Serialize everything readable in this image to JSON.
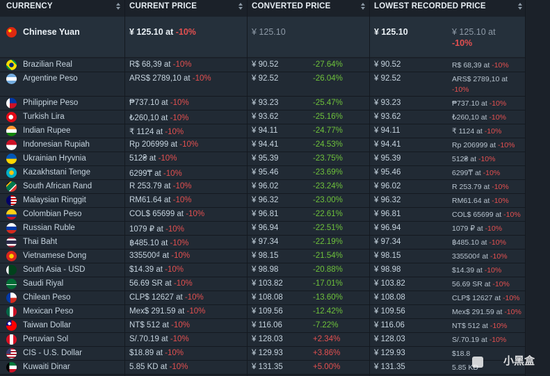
{
  "headers": {
    "currency": "CURRENCY",
    "current_price": "CURRENT PRICE",
    "converted_price": "CONVERTED PRICE",
    "lowest_recorded_price": "LOWEST RECORDED PRICE"
  },
  "featured": {
    "currency": "Chinese Yuan",
    "current": "¥ 125.10 at ",
    "current_disc": "-10%",
    "converted": "¥ 125.10",
    "lowest": "¥ 125.10",
    "lowest_at": "¥ 125.10 at",
    "lowest_disc": "-10%"
  },
  "rows": [
    {
      "currency": "Brazilian Real",
      "current": "R$ 68,39 at ",
      "disc": "-10%",
      "converted": "¥ 90.52",
      "pct": "-27.64%",
      "lowest": "¥ 90.52",
      "lowest_at": "R$ 68,39 at ",
      "lowest_disc": "-10%"
    },
    {
      "currency": "Argentine Peso",
      "current": "ARS$ 2789,10 at ",
      "disc": "-10%",
      "converted": "¥ 92.52",
      "pct": "-26.04%",
      "lowest": "¥ 92.52",
      "lowest_at": "ARS$ 2789,10 at",
      "lowest_disc": "-10%"
    },
    {
      "currency": "Philippine Peso",
      "current": "₱737.10 at ",
      "disc": "-10%",
      "converted": "¥ 93.23",
      "pct": "-25.47%",
      "lowest": "¥ 93.23",
      "lowest_at": "₱737.10 at ",
      "lowest_disc": "-10%"
    },
    {
      "currency": "Turkish Lira",
      "current": "₺260,10 at ",
      "disc": "-10%",
      "converted": "¥ 93.62",
      "pct": "-25.16%",
      "lowest": "¥ 93.62",
      "lowest_at": "₺260,10 at ",
      "lowest_disc": "-10%"
    },
    {
      "currency": "Indian Rupee",
      "current": "₹ 1124 at ",
      "disc": "-10%",
      "converted": "¥ 94.11",
      "pct": "-24.77%",
      "lowest": "¥ 94.11",
      "lowest_at": "₹ 1124 at ",
      "lowest_disc": "-10%"
    },
    {
      "currency": "Indonesian Rupiah",
      "current": "Rp 206999 at ",
      "disc": "-10%",
      "converted": "¥ 94.41",
      "pct": "-24.53%",
      "lowest": "¥ 94.41",
      "lowest_at": "Rp 206999 at ",
      "lowest_disc": "-10%"
    },
    {
      "currency": "Ukrainian Hryvnia",
      "current": "512₴ at ",
      "disc": "-10%",
      "converted": "¥ 95.39",
      "pct": "-23.75%",
      "lowest": "¥ 95.39",
      "lowest_at": "512₴ at ",
      "lowest_disc": "-10%"
    },
    {
      "currency": "Kazakhstani Tenge",
      "current": "6299₸ at ",
      "disc": "-10%",
      "converted": "¥ 95.46",
      "pct": "-23.69%",
      "lowest": "¥ 95.46",
      "lowest_at": "6299₸ at ",
      "lowest_disc": "-10%"
    },
    {
      "currency": "South African Rand",
      "current": "R 253.79 at ",
      "disc": "-10%",
      "converted": "¥ 96.02",
      "pct": "-23.24%",
      "lowest": "¥ 96.02",
      "lowest_at": "R 253.79 at ",
      "lowest_disc": "-10%"
    },
    {
      "currency": "Malaysian Ringgit",
      "current": "RM61.64 at ",
      "disc": "-10%",
      "converted": "¥ 96.32",
      "pct": "-23.00%",
      "lowest": "¥ 96.32",
      "lowest_at": "RM61.64 at ",
      "lowest_disc": "-10%"
    },
    {
      "currency": "Colombian Peso",
      "current": "COL$ 65699 at ",
      "disc": "-10%",
      "converted": "¥ 96.81",
      "pct": "-22.61%",
      "lowest": "¥ 96.81",
      "lowest_at": "COL$ 65699 at ",
      "lowest_disc": "-10%"
    },
    {
      "currency": "Russian Ruble",
      "current": "1079 ₽ at ",
      "disc": "-10%",
      "converted": "¥ 96.94",
      "pct": "-22.51%",
      "lowest": "¥ 96.94",
      "lowest_at": "1079 ₽ at ",
      "lowest_disc": "-10%"
    },
    {
      "currency": "Thai Baht",
      "current": "฿485.10 at ",
      "disc": "-10%",
      "converted": "¥ 97.34",
      "pct": "-22.19%",
      "lowest": "¥ 97.34",
      "lowest_at": "฿485.10 at ",
      "lowest_disc": "-10%"
    },
    {
      "currency": "Vietnamese Dong",
      "current": "335500₫ at ",
      "disc": "-10%",
      "converted": "¥ 98.15",
      "pct": "-21.54%",
      "lowest": "¥ 98.15",
      "lowest_at": "335500₫ at ",
      "lowest_disc": "-10%"
    },
    {
      "currency": "South Asia - USD",
      "current": "$14.39 at ",
      "disc": "-10%",
      "converted": "¥ 98.98",
      "pct": "-20.88%",
      "lowest": "¥ 98.98",
      "lowest_at": "$14.39 at ",
      "lowest_disc": "-10%"
    },
    {
      "currency": "Saudi Riyal",
      "current": "56.69 SR at ",
      "disc": "-10%",
      "converted": "¥ 103.82",
      "pct": "-17.01%",
      "lowest": "¥ 103.82",
      "lowest_at": "56.69 SR at ",
      "lowest_disc": "-10%"
    },
    {
      "currency": "Chilean Peso",
      "current": "CLP$ 12627 at ",
      "disc": "-10%",
      "converted": "¥ 108.08",
      "pct": "-13.60%",
      "lowest": "¥ 108.08",
      "lowest_at": "CLP$ 12627 at ",
      "lowest_disc": "-10%"
    },
    {
      "currency": "Mexican Peso",
      "current": "Mex$ 291.59 at ",
      "disc": "-10%",
      "converted": "¥ 109.56",
      "pct": "-12.42%",
      "lowest": "¥ 109.56",
      "lowest_at": "Mex$ 291.59 at ",
      "lowest_disc": "-10%"
    },
    {
      "currency": "Taiwan Dollar",
      "current": "NT$ 512 at ",
      "disc": "-10%",
      "converted": "¥ 116.06",
      "pct": "-7.22%",
      "lowest": "¥ 116.06",
      "lowest_at": "NT$ 512 at ",
      "lowest_disc": "-10%"
    },
    {
      "currency": "Peruvian Sol",
      "current": "S/.70.19 at ",
      "disc": "-10%",
      "converted": "¥ 128.03",
      "pct": "+2.34%",
      "lowest": "¥ 128.03",
      "lowest_at": "S/.70.19 at ",
      "lowest_disc": "-10%"
    },
    {
      "currency": "CIS - U.S. Dollar",
      "current": "$18.89 at ",
      "disc": "-10%",
      "converted": "¥ 129.93",
      "pct": "+3.86%",
      "lowest": "¥ 129.93",
      "lowest_at": "$18.8",
      "lowest_disc": ""
    },
    {
      "currency": "Kuwaiti Dinar",
      "current": "5.85 KD at ",
      "disc": "-10%",
      "converted": "¥ 131.35",
      "pct": "+5.00%",
      "lowest": "¥ 131.35",
      "lowest_at": "5.85 KD",
      "lowest_disc": ""
    }
  ],
  "watermark": "小黑盒",
  "flags": [
    "cn",
    "br",
    "ar",
    "ph",
    "tr",
    "in",
    "id",
    "ua",
    "kz",
    "za",
    "my",
    "co",
    "ru",
    "th",
    "vn",
    "pk",
    "sa",
    "cl",
    "mx",
    "tw",
    "pe",
    "us",
    "kw"
  ]
}
